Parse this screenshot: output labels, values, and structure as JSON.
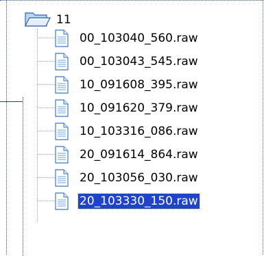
{
  "tree": {
    "folder": {
      "label": "11",
      "icon": "open-folder-icon"
    },
    "files": [
      {
        "label": "00_103040_560.raw",
        "icon": "file-icon",
        "selected": false
      },
      {
        "label": "00_103043_545.raw",
        "icon": "file-icon",
        "selected": false
      },
      {
        "label": "10_091608_395.raw",
        "icon": "file-icon",
        "selected": false
      },
      {
        "label": "10_091620_379.raw",
        "icon": "file-icon",
        "selected": false
      },
      {
        "label": "10_103316_086.raw",
        "icon": "file-icon",
        "selected": false
      },
      {
        "label": "20_091614_864.raw",
        "icon": "file-icon",
        "selected": false
      },
      {
        "label": "20_103056_030.raw",
        "icon": "file-icon",
        "selected": false
      },
      {
        "label": "20_103330_150.raw",
        "icon": "file-icon",
        "selected": true
      }
    ]
  },
  "colors": {
    "selection_bg": "#1f43c9",
    "selection_text": "#ffffff",
    "focus_outline": "#f5d000",
    "connector": "#a0a0a0",
    "folder_blue": "#3c7fc4",
    "file_blue": "#4f8fd6"
  }
}
